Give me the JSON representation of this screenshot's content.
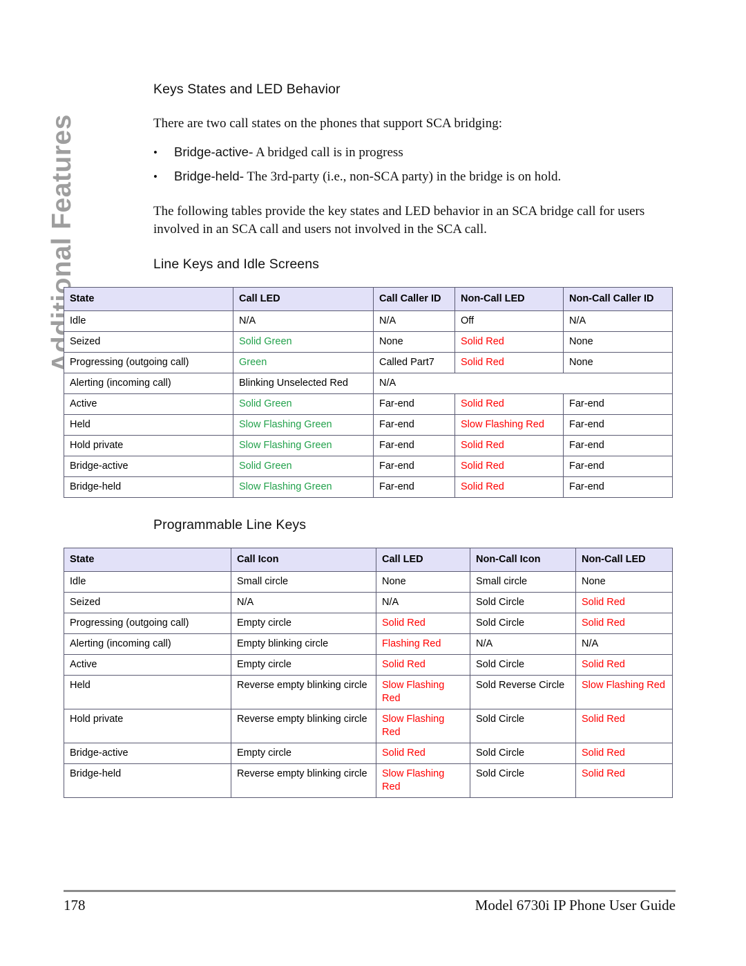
{
  "sidebar": {
    "chapter_label": "Additional Features",
    "color": "#9e9e9e"
  },
  "colors": {
    "header_bg": "#e2e1f8",
    "border": "#5a5a72",
    "green": "#22a14b",
    "red": "#ff0000",
    "black": "#000000"
  },
  "content": {
    "heading_1": "Keys States and LED Behavior",
    "intro_paragraph": "There are two call states on the phones that support SCA bridging:",
    "bullets": [
      {
        "marker": "•",
        "term": "Bridge-active",
        "desc": "- A bridged call is in progress"
      },
      {
        "marker": "•",
        "term": "Bridge-held",
        "desc": "- The 3rd-party (i.e., non-SCA party) in the bridge is on hold."
      }
    ],
    "body_paragraph": "The following tables provide the key states and LED behavior in an SCA bridge call for users involved in an SCA call and users not involved in the SCA call.",
    "heading_2": "Line Keys and Idle Screens",
    "heading_3": "Programmable Line Keys"
  },
  "table_line_keys": {
    "headers": [
      "State",
      "Call LED",
      "Call Caller ID",
      "Non-Call LED",
      "Non-Call Caller ID"
    ],
    "rows": [
      {
        "cells": [
          {
            "text": "Idle",
            "color": "black"
          },
          {
            "text": "N/A",
            "color": "black"
          },
          {
            "text": "N/A",
            "color": "black"
          },
          {
            "text": "Off",
            "color": "black"
          },
          {
            "text": "N/A",
            "color": "black"
          }
        ]
      },
      {
        "cells": [
          {
            "text": "Seized",
            "color": "black"
          },
          {
            "text": "Solid Green",
            "color": "green"
          },
          {
            "text": "None",
            "color": "black"
          },
          {
            "text": "Solid Red",
            "color": "red"
          },
          {
            "text": "None",
            "color": "black"
          }
        ]
      },
      {
        "cells": [
          {
            "text": "Progressing (outgoing call)",
            "color": "black"
          },
          {
            "text": "Green",
            "color": "green"
          },
          {
            "text": "Called Part7",
            "color": "black"
          },
          {
            "text": "Solid Red",
            "color": "red"
          },
          {
            "text": "None",
            "color": "black"
          }
        ]
      },
      {
        "cells": [
          {
            "text": "Alerting (incoming call)",
            "color": "black"
          },
          {
            "text": "Blinking Unselected Red",
            "color": "black"
          },
          {
            "text": "N/A",
            "color": "black",
            "colspan": 3
          }
        ]
      },
      {
        "cells": [
          {
            "text": "Active",
            "color": "black"
          },
          {
            "text": "Solid Green",
            "color": "green"
          },
          {
            "text": "Far-end",
            "color": "black"
          },
          {
            "text": "Solid Red",
            "color": "red"
          },
          {
            "text": "Far-end",
            "color": "black"
          }
        ]
      },
      {
        "cells": [
          {
            "text": "Held",
            "color": "black"
          },
          {
            "text": "Slow Flashing Green",
            "color": "green"
          },
          {
            "text": "Far-end",
            "color": "black"
          },
          {
            "text": "Slow Flashing Red",
            "color": "red"
          },
          {
            "text": "Far-end",
            "color": "black"
          }
        ]
      },
      {
        "cells": [
          {
            "text": "Hold private",
            "color": "black"
          },
          {
            "text": "Slow Flashing Green",
            "color": "green"
          },
          {
            "text": "Far-end",
            "color": "black"
          },
          {
            "text": "Solid Red",
            "color": "red"
          },
          {
            "text": "Far-end",
            "color": "black"
          }
        ]
      },
      {
        "cells": [
          {
            "text": "Bridge-active",
            "color": "black"
          },
          {
            "text": "Solid Green",
            "color": "green"
          },
          {
            "text": "Far-end",
            "color": "black"
          },
          {
            "text": "Solid Red",
            "color": "red"
          },
          {
            "text": "Far-end",
            "color": "black"
          }
        ]
      },
      {
        "cells": [
          {
            "text": "Bridge-held",
            "color": "black"
          },
          {
            "text": "Slow Flashing Green",
            "color": "green"
          },
          {
            "text": "Far-end",
            "color": "black"
          },
          {
            "text": "Solid Red",
            "color": "red"
          },
          {
            "text": "Far-end",
            "color": "black"
          }
        ]
      }
    ]
  },
  "table_programmable_keys": {
    "headers": [
      "State",
      "Call Icon",
      "Call LED",
      "Non-Call Icon",
      "Non-Call LED"
    ],
    "rows": [
      {
        "cells": [
          {
            "text": "Idle",
            "color": "black"
          },
          {
            "text": "Small circle",
            "color": "black"
          },
          {
            "text": "None",
            "color": "black"
          },
          {
            "text": "Small circle",
            "color": "black"
          },
          {
            "text": "None",
            "color": "black"
          }
        ]
      },
      {
        "cells": [
          {
            "text": "Seized",
            "color": "black"
          },
          {
            "text": "N/A",
            "color": "black"
          },
          {
            "text": "N/A",
            "color": "black"
          },
          {
            "text": "Sold Circle",
            "color": "black"
          },
          {
            "text": "Solid Red",
            "color": "red"
          }
        ]
      },
      {
        "cells": [
          {
            "text": "Progressing (outgoing call)",
            "color": "black"
          },
          {
            "text": "Empty circle",
            "color": "black"
          },
          {
            "text": "Solid Red",
            "color": "red"
          },
          {
            "text": "Sold Circle",
            "color": "black"
          },
          {
            "text": "Solid Red",
            "color": "red"
          }
        ]
      },
      {
        "cells": [
          {
            "text": "Alerting (incoming call)",
            "color": "black"
          },
          {
            "text": "Empty blinking circle",
            "color": "black"
          },
          {
            "text": "Flashing Red",
            "color": "red"
          },
          {
            "text": "N/A",
            "color": "black"
          },
          {
            "text": "N/A",
            "color": "black"
          }
        ]
      },
      {
        "cells": [
          {
            "text": "Active",
            "color": "black"
          },
          {
            "text": "Empty circle",
            "color": "black"
          },
          {
            "text": "Solid Red",
            "color": "red"
          },
          {
            "text": "Sold Circle",
            "color": "black"
          },
          {
            "text": "Solid Red",
            "color": "red"
          }
        ]
      },
      {
        "cells": [
          {
            "text": "Held",
            "color": "black"
          },
          {
            "text": "Reverse empty blinking circle",
            "color": "black"
          },
          {
            "text": "Slow Flashing Red",
            "color": "red"
          },
          {
            "text": "Sold Reverse Circle",
            "color": "black"
          },
          {
            "text": "Slow Flashing Red",
            "color": "red"
          }
        ]
      },
      {
        "cells": [
          {
            "text": "Hold private",
            "color": "black"
          },
          {
            "text": "Reverse empty blinking circle",
            "color": "black"
          },
          {
            "text": "Slow Flashing Red",
            "color": "red"
          },
          {
            "text": "Sold Circle",
            "color": "black"
          },
          {
            "text": "Solid Red",
            "color": "red"
          }
        ]
      },
      {
        "cells": [
          {
            "text": "Bridge-active",
            "color": "black"
          },
          {
            "text": "Empty circle",
            "color": "black"
          },
          {
            "text": "Solid Red",
            "color": "red"
          },
          {
            "text": "Sold Circle",
            "color": "black"
          },
          {
            "text": "Solid Red",
            "color": "red"
          }
        ]
      },
      {
        "cells": [
          {
            "text": "Bridge-held",
            "color": "black"
          },
          {
            "text": "Reverse empty blinking circle",
            "color": "black"
          },
          {
            "text": "Slow Flashing Red",
            "color": "red"
          },
          {
            "text": "Sold Circle",
            "color": "black"
          },
          {
            "text": "Solid Red",
            "color": "red"
          }
        ]
      }
    ]
  },
  "footer": {
    "page_number": "178",
    "guide_title": "Model 6730i IP Phone User Guide"
  }
}
